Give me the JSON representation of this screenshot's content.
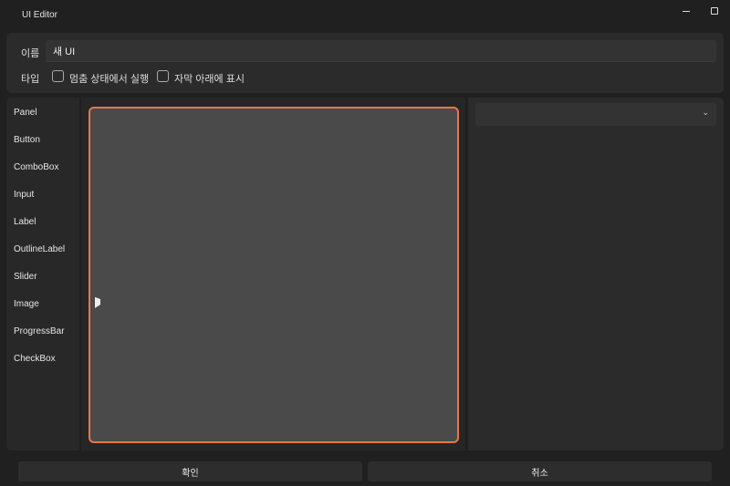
{
  "window": {
    "title": "UI Editor"
  },
  "form": {
    "name_label": "이름",
    "name_value": "새 UI",
    "type_label": "타입",
    "checkboxes": [
      {
        "label": "멈춤 상태에서 실행",
        "checked": false
      },
      {
        "label": "자막 아래에 표시",
        "checked": false
      }
    ]
  },
  "components": [
    "Panel",
    "Button",
    "ComboBox",
    "Input",
    "Label",
    "OutlineLabel",
    "Slider",
    "Image",
    "ProgressBar",
    "CheckBox"
  ],
  "properties": {
    "dropdown_value": ""
  },
  "buttons": {
    "ok": "확인",
    "cancel": "취소"
  },
  "colors": {
    "selection_border": "#e8764a",
    "canvas": "#4a4a4a"
  }
}
